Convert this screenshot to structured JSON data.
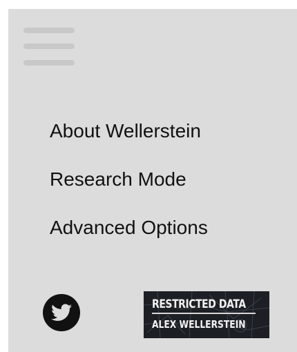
{
  "menu": {
    "toggle_icon": "hamburger-menu-icon",
    "items": [
      {
        "label": "About Wellerstein"
      },
      {
        "label": "Research Mode"
      },
      {
        "label": "Advanced Options"
      }
    ]
  },
  "footer": {
    "social_icon": "twitter-bird-icon",
    "logo": {
      "line1": "RESTRICTED DATA",
      "line2": "ALEX WELLERSTEIN"
    }
  },
  "colors": {
    "panel_background": "#dcdcdc",
    "hamburger_bars": "#c8c8c8",
    "menu_text": "#111111",
    "twitter_circle": "#111111",
    "logo_background": "#1c1f24"
  }
}
